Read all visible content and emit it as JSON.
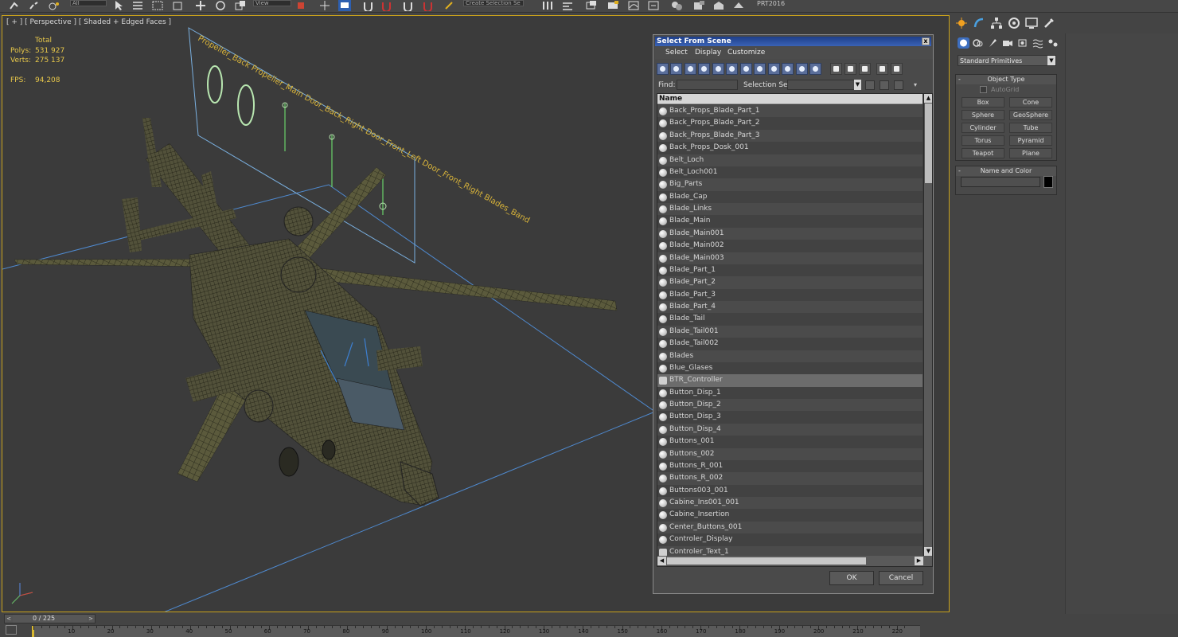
{
  "toolbar": {
    "combo_all": "All",
    "combo_view": "View",
    "combo_selection_set": "Create Selection Se",
    "project": "PRT2016"
  },
  "viewport": {
    "label": "[ + ] [ Perspective ] [ Shaded + Edged Faces ]",
    "stats": {
      "total_label": "Total",
      "polys_label": "Polys:",
      "polys_value": "531 927",
      "verts_label": "Verts:",
      "verts_value": "275 137",
      "fps_label": "FPS:",
      "fps_value": "94,208"
    },
    "plane_text": "Propeller_Back  Propeller_Main  Door_Back_Right  Door_Front_Left  Door_Front_Right  Blades_Band"
  },
  "dialog": {
    "title": "Select From Scene",
    "close": "x",
    "menus": [
      "Select",
      "Display",
      "Customize"
    ],
    "find_label": "Find:",
    "find_value": "",
    "selection_set_label": "Selection Set:",
    "column_header": "Name",
    "rows": [
      {
        "name": "Back_Props_Blade_Part_1",
        "icon": "sphere-icon"
      },
      {
        "name": "Back_Props_Blade_Part_2",
        "icon": "sphere-icon"
      },
      {
        "name": "Back_Props_Blade_Part_3",
        "icon": "sphere-icon"
      },
      {
        "name": "Back_Props_Dosk_001",
        "icon": "sphere-icon"
      },
      {
        "name": "Belt_Loch",
        "icon": "sphere-icon"
      },
      {
        "name": "Belt_Loch001",
        "icon": "sphere-icon"
      },
      {
        "name": "Big_Parts",
        "icon": "sphere-icon"
      },
      {
        "name": "Blade_Cap",
        "icon": "sphere-icon"
      },
      {
        "name": "Blade_Links",
        "icon": "sphere-icon"
      },
      {
        "name": "Blade_Main",
        "icon": "sphere-icon"
      },
      {
        "name": "Blade_Main001",
        "icon": "sphere-icon"
      },
      {
        "name": "Blade_Main002",
        "icon": "sphere-icon"
      },
      {
        "name": "Blade_Main003",
        "icon": "sphere-icon"
      },
      {
        "name": "Blade_Part_1",
        "icon": "sphere-icon"
      },
      {
        "name": "Blade_Part_2",
        "icon": "sphere-icon"
      },
      {
        "name": "Blade_Part_3",
        "icon": "sphere-icon"
      },
      {
        "name": "Blade_Part_4",
        "icon": "sphere-icon"
      },
      {
        "name": "Blade_Tail",
        "icon": "sphere-icon"
      },
      {
        "name": "Blade_Tail001",
        "icon": "sphere-icon"
      },
      {
        "name": "Blade_Tail002",
        "icon": "sphere-icon"
      },
      {
        "name": "Blades",
        "icon": "sphere-icon"
      },
      {
        "name": "Blue_Glases",
        "icon": "sphere-icon"
      },
      {
        "name": "BTR_Controller",
        "icon": "controller-icon",
        "selected": true
      },
      {
        "name": "Button_Disp_1",
        "icon": "sphere-icon"
      },
      {
        "name": "Button_Disp_2",
        "icon": "sphere-icon"
      },
      {
        "name": "Button_Disp_3",
        "icon": "sphere-icon"
      },
      {
        "name": "Button_Disp_4",
        "icon": "sphere-icon"
      },
      {
        "name": "Buttons_001",
        "icon": "sphere-icon"
      },
      {
        "name": "Buttons_002",
        "icon": "sphere-icon"
      },
      {
        "name": "Buttons_R_001",
        "icon": "sphere-icon"
      },
      {
        "name": "Buttons_R_002",
        "icon": "sphere-icon"
      },
      {
        "name": "Buttons003_001",
        "icon": "sphere-icon"
      },
      {
        "name": "Cabine_Ins001_001",
        "icon": "sphere-icon"
      },
      {
        "name": "Cabine_Insertion",
        "icon": "sphere-icon"
      },
      {
        "name": "Center_Buttons_001",
        "icon": "sphere-icon"
      },
      {
        "name": "Controler_Display",
        "icon": "sphere-icon"
      },
      {
        "name": "Controler_Text_1",
        "icon": "controller-icon"
      }
    ],
    "ok_label": "OK",
    "cancel_label": "Cancel"
  },
  "command_panel": {
    "category": "Standard Primitives",
    "object_type_title": "Object Type",
    "autogrid_label": "AutoGrid",
    "primitives": [
      "Box",
      "Cone",
      "Sphere",
      "GeoSphere",
      "Cylinder",
      "Tube",
      "Torus",
      "Pyramid",
      "Teapot",
      "Plane"
    ],
    "name_color_title": "Name and Color",
    "color": "#000000"
  },
  "timeline": {
    "frame_label": "0 / 225",
    "prev": "<",
    "next": ">",
    "ticks": [
      "10",
      "20",
      "30",
      "40",
      "50",
      "60",
      "70",
      "80",
      "90",
      "100",
      "110",
      "120",
      "130",
      "140",
      "150",
      "160",
      "170",
      "180",
      "190",
      "200",
      "210",
      "220"
    ]
  }
}
